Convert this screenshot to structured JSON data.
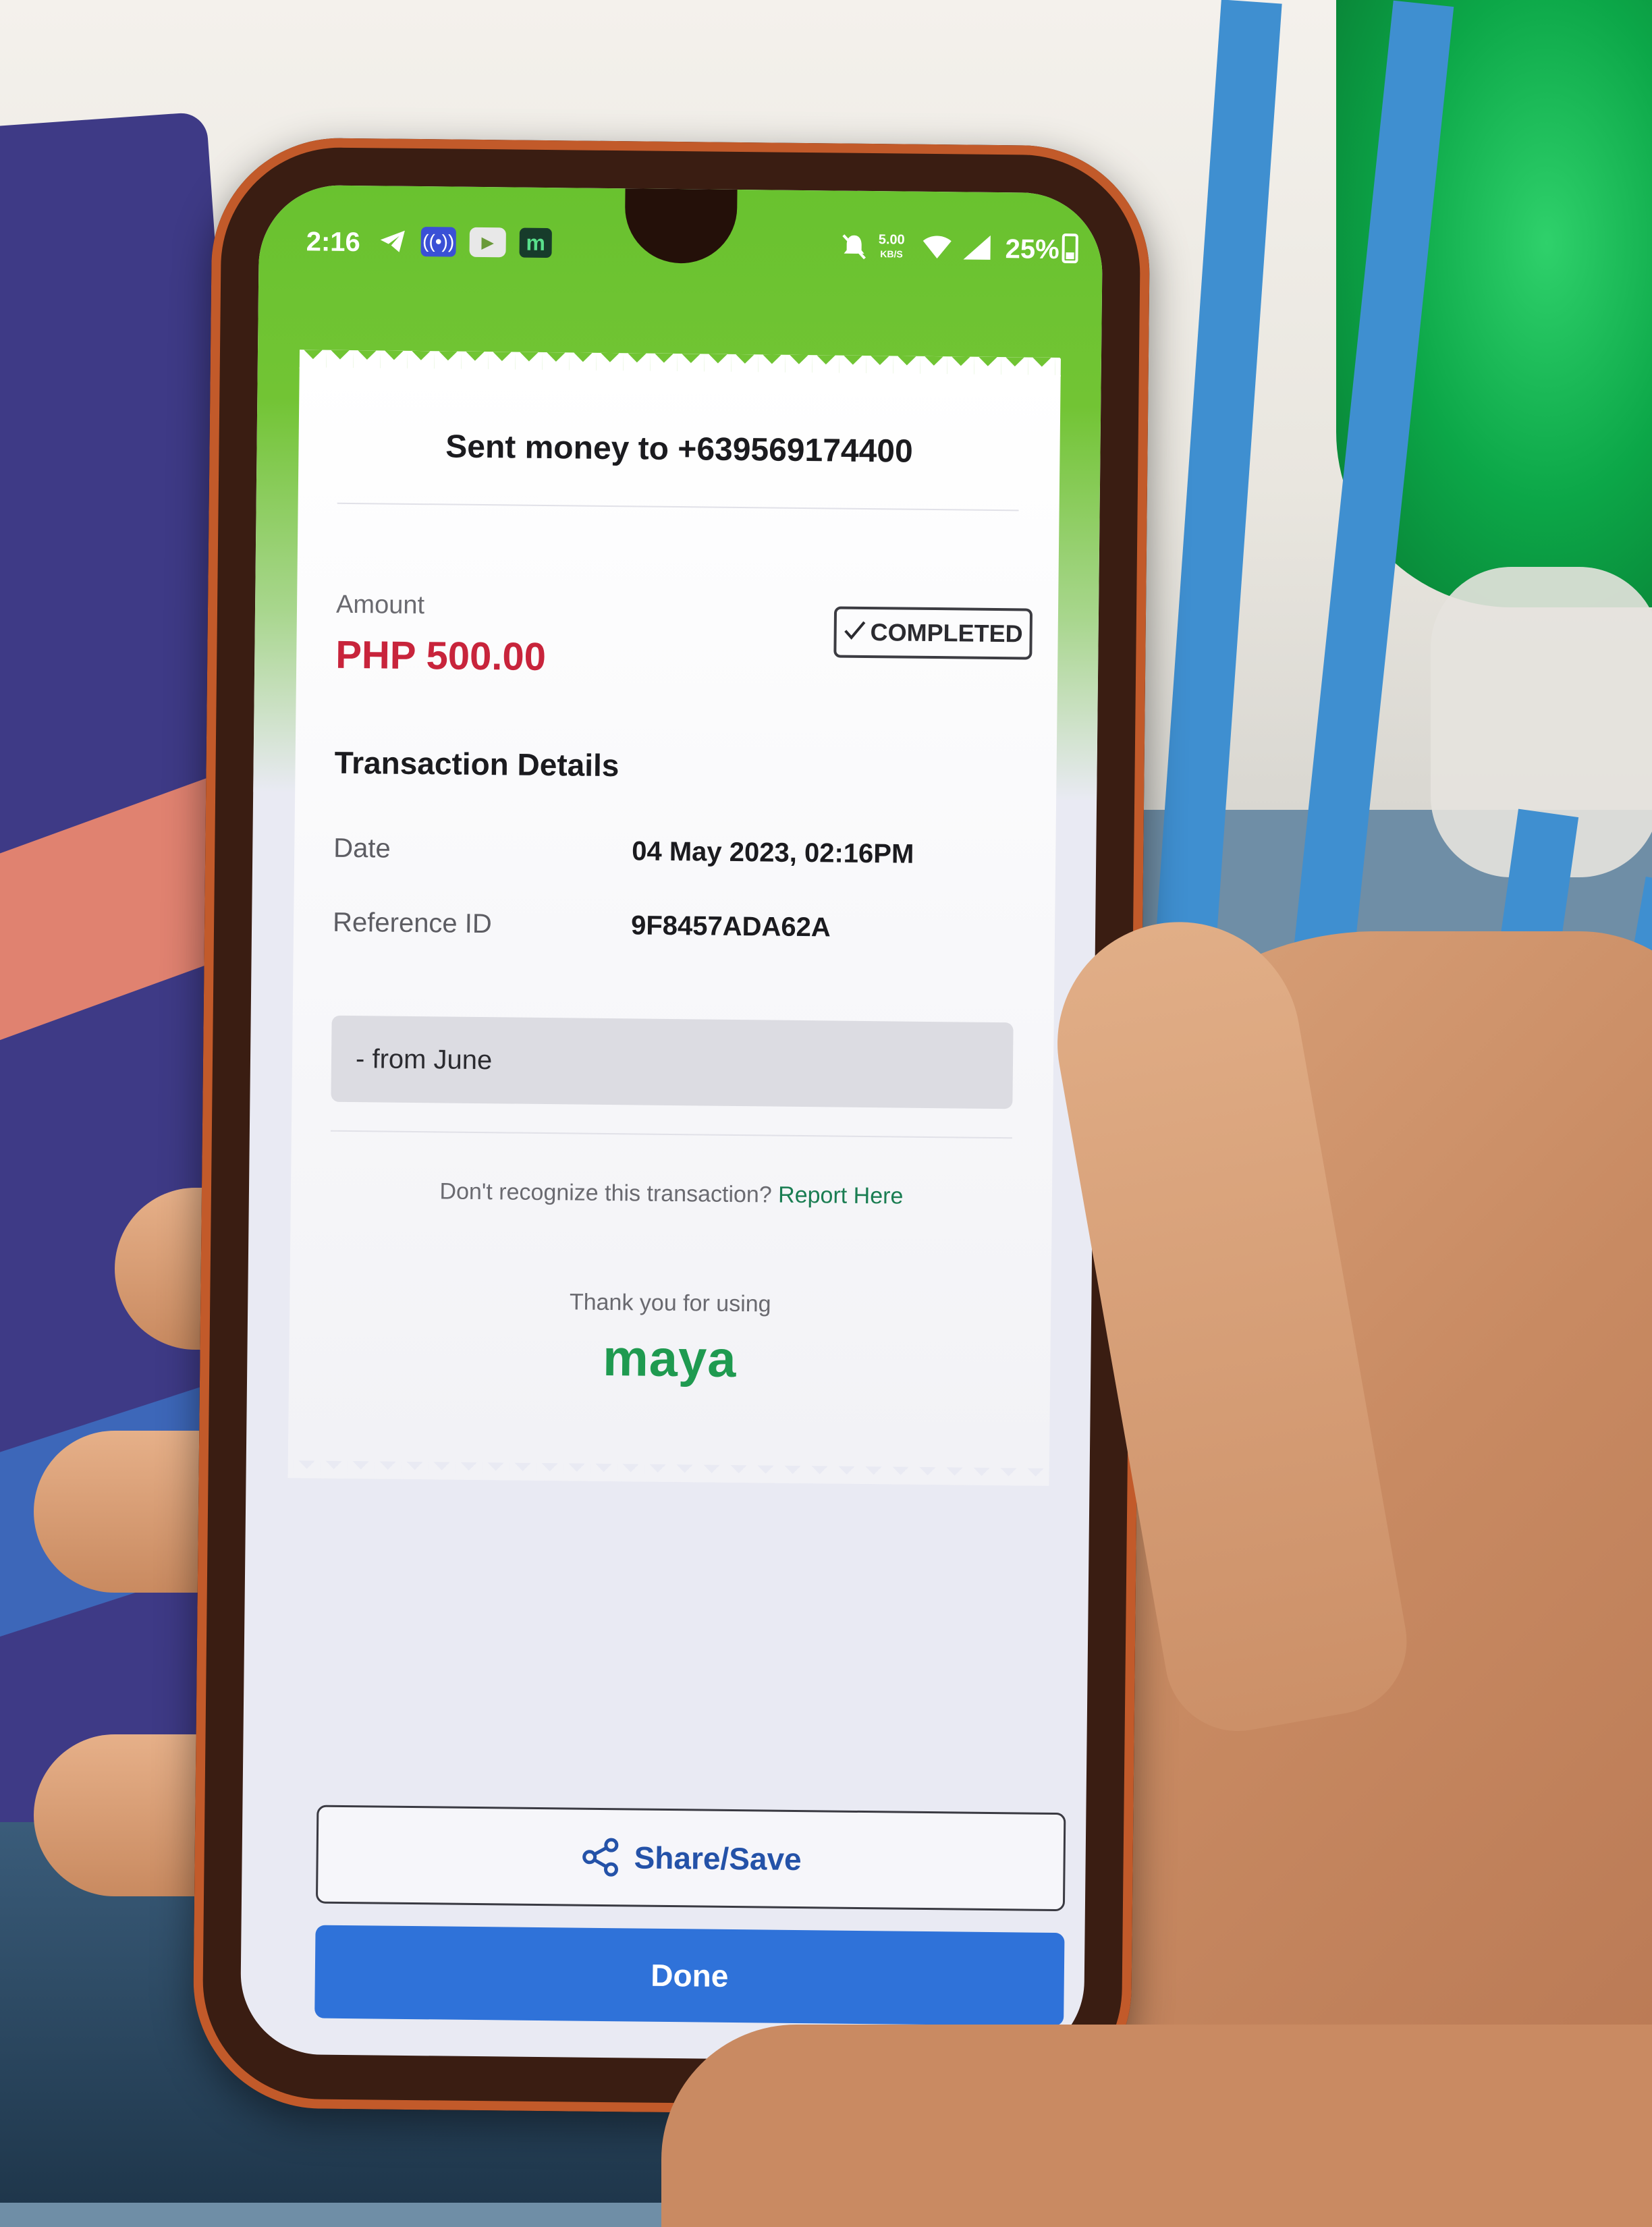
{
  "status_bar": {
    "time": "2:16",
    "net_speed": "5.00",
    "net_speed_unit": "KB/S",
    "battery": "25%"
  },
  "receipt": {
    "title": "Sent money to +639569174400",
    "amount_label": "Amount",
    "amount": "PHP 500.00",
    "status": "COMPLETED",
    "details_heading": "Transaction Details",
    "date_label": "Date",
    "date_value": "04 May 2023, 02:16PM",
    "reference_label": "Reference ID",
    "reference_value": "9F8457ADA62A",
    "note": "- from June",
    "report_question": "Don't recognize this transaction?",
    "report_link": "Report Here",
    "thanks": "Thank you for using",
    "brand": "maya"
  },
  "actions": {
    "share_label": "Share/Save",
    "done_label": "Done"
  },
  "colors": {
    "brand_green": "#69c22f",
    "amount_red": "#c8243b",
    "primary_blue": "#2f72d9",
    "link_green": "#1a7d52"
  },
  "icons": [
    "telegram-icon",
    "radio-icon",
    "youtube-icon",
    "m-app-icon",
    "bell-muted-icon",
    "wifi-icon",
    "signal-icon",
    "battery-icon",
    "check-icon",
    "share-icon"
  ]
}
